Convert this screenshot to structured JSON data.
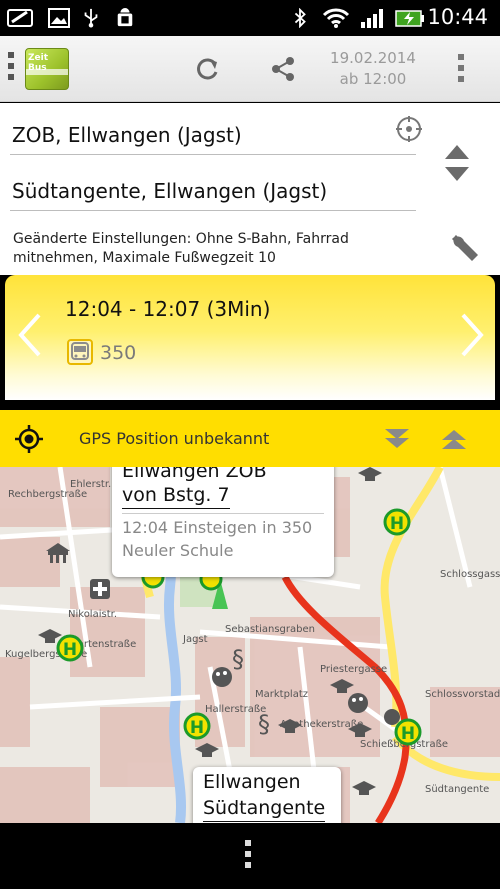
{
  "status_bar": {
    "time": "10:44",
    "icons": [
      "screenshot-icon",
      "gallery-icon",
      "usb-icon",
      "android-debug-icon",
      "bluetooth-icon",
      "wifi-icon",
      "signal-icon",
      "battery-charging-icon"
    ]
  },
  "action_bar": {
    "logo_text": "Zeit Bus",
    "date": "19.02.2014",
    "time": "ab 12:00",
    "icons": [
      "drawer-icon",
      "app-logo",
      "refresh-icon",
      "share-icon",
      "overflow-menu-icon"
    ]
  },
  "form": {
    "from": "ZOB, Ellwangen (Jagst)",
    "to": "Südtangente, Ellwangen (Jagst)",
    "settings_note": "Geänderte Einstellungen: Ohne S-Bahn, Fahrrad mitnehmen, Maximale Fußwegzeit 10",
    "icons": [
      "locate-icon",
      "swap-icon",
      "wrench-icon"
    ]
  },
  "connection": {
    "times": "12:04  -  12:07 (3Min)",
    "line": "350",
    "icons": [
      "chevron-left-icon",
      "chevron-right-icon",
      "bus-icon"
    ]
  },
  "gps_bar": {
    "text": "GPS Position unbekannt",
    "icons": [
      "gps-icon",
      "expand-down-icon",
      "collapse-up-icon"
    ]
  },
  "map": {
    "origin": {
      "title": "Ellwangen ZOB",
      "subtitle": "von Bstg. 7",
      "detail_1": "12:04 Einsteigen in 350",
      "detail_2": "Neuler Schule"
    },
    "destination": {
      "title": "Ellwangen",
      "subtitle": "Südtangente"
    },
    "street_labels": [
      "Rechbergstraße",
      "Ehlerstr.",
      "Kugelbergstraße",
      "Nikolaistr.",
      "Gartenstraße",
      "Jagst",
      "Sebastiansgraben",
      "Schlossgasse",
      "Schlossvorstadt",
      "Priestergasse",
      "Marktplatz",
      "Apothekerstraße",
      "Südtangente",
      "Schießbergstraße",
      "Hallerstraße"
    ],
    "route_color": "#e8341c",
    "road_color": "#ffe869",
    "stop_color": "#f2e200"
  },
  "nav_bar": {
    "icons": [
      "menu-icon"
    ]
  }
}
